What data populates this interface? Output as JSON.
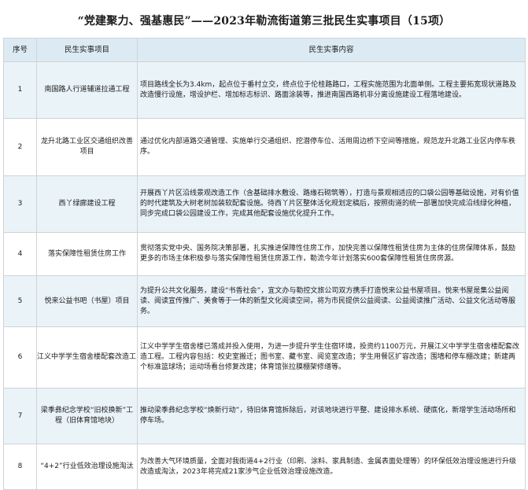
{
  "title": "“党建聚力、强基惠民”——2023年勒流街道第三批民生实事项目（15项）",
  "columns": {
    "seq": "序号",
    "name": "民生实事项目",
    "content": "民生实事内容"
  },
  "rows": [
    {
      "seq": "1",
      "name": "南国路人行道辅道拉通工程",
      "content": "项目路线全长为3.4km，起点位于番村立交，终点位于伦桂路路口，工程实施范围为北面单侧。工程主要拓宽现状道路及改造慢行设施，增设护栏、增加标志标识、路面涂装等，推进南国西路机非分离设施建设工程落地建设。"
    },
    {
      "seq": "2",
      "name": "龙升北路工业区交通组织改善项目",
      "content": "通过优化内部道路交通管理、实施单行交通组织、挖潜停车位、活用周边桥下空间等措施，规范龙升北路工业区内停车秩序。"
    },
    {
      "seq": "3",
      "name": "西丫绿廊建设工程",
      "content": "开展西丫片区沿线景观改造工作（含基础排水敷设、路缘石砌筑等），打造与景观相适应的口袋公园等基础设施，对有价值的时代建筑及大树老树加装软配套设施。待西丫片区整体活化规划定稿后，按照街道的统一部署加快完成沿线绿化种植，同步完成口袋公园建设工作，完成其他配套设施优化提升工作。"
    },
    {
      "seq": "4",
      "name": "落实保障性租赁住房工作",
      "content": "贯彻落实党中央、国务院决策部署，扎实推进保障性住房工作，加快完善以保障性租赁住房为主体的住房保障体系，鼓励更多的市场主体积极参与落实保障性租赁住房源工作，勒流今年计划落实600套保障性租赁住房房源。"
    },
    {
      "seq": "5",
      "name": "悦来公益书吧（书屋）项目",
      "content": "为提升公共文化服务，建设“书香社会”，宜文办与勒控文旅公司双方携手打造悦来公益书屋项目。悦来书屋是集公益阅读、阅读宣传推广、美食等于一体的新型文化阅读空间，将为市民提供公益阅读、公益阅读推广活动、公益文化活动等服务。"
    },
    {
      "seq": "6",
      "name": "江义中学学生宿舍楼配套改造工",
      "content": "江义中学学生宿舍楼已落成并投入使用，为进一步提升学生住宿环境，投资约1100万元，开展江义中学学生宿舍楼配套改造工程。工程内容包括：校史室搬迁；图书室、藏书室、阅览室改造；学生用餐区扩容改造；围墙和停车棚改建；新建两个标准篮球场；运动场看台修复改建；体育馆张拉膜棚架修缮等。"
    },
    {
      "seq": "7",
      "name": "梁季彝纪念学校“旧校换新”工程（旧体育馆地块）",
      "content": "推动梁季彝纪念学校“焕新行动”，待旧体育馆拆除后，对该地块进行平整、建设排水系统、硬底化，新增学生活动场所和停车场。"
    },
    {
      "seq": "8",
      "name": "“4+2”行业低效治理设施淘汰",
      "content": "为改善大气环境质量，全面对我街道4+2行业（印刷、涂料、家具制造、金属表面处理等）的环保低效治理设施进行升级改造或淘汰，2023年将完成21家涉气企业低效治理设施改造。"
    }
  ]
}
